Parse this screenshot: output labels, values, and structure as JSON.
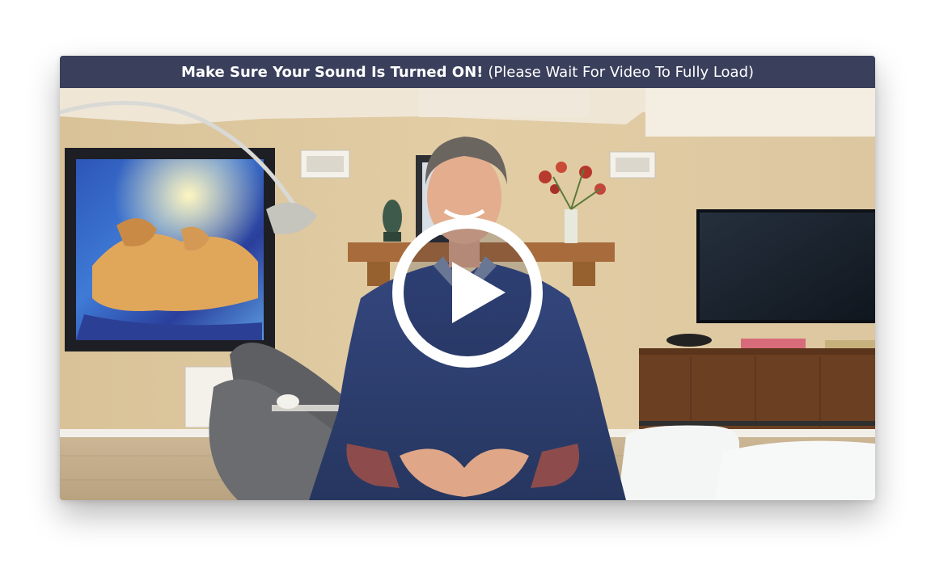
{
  "banner": {
    "bold": "Make Sure Your Sound Is Turned ON!",
    "normal": "(Please Wait For Video To Fully Load)"
  },
  "player": {
    "play_icon": "play-icon",
    "play_button_color": "#ffffff",
    "title_bar_color": "#3a3f5c"
  }
}
